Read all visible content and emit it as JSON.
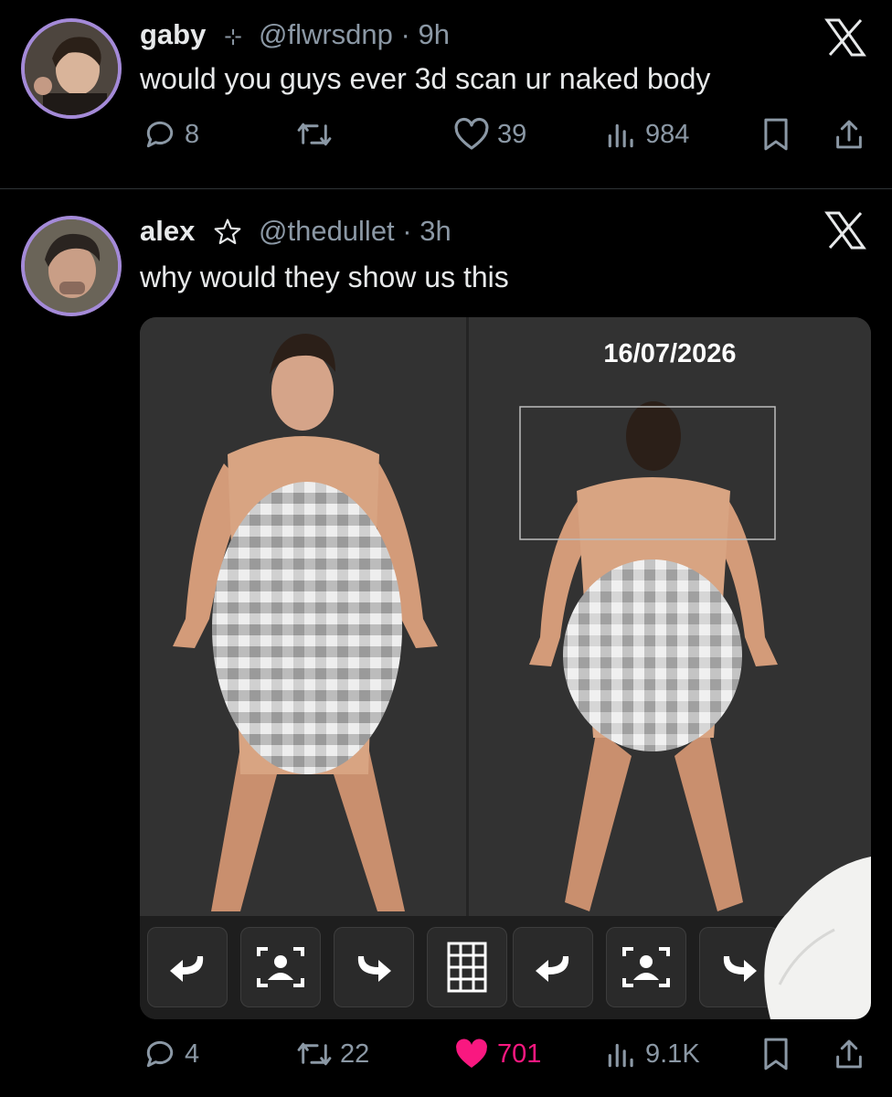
{
  "post1": {
    "display_name": "gaby",
    "handle_time": "@flwrsdnp · 9h",
    "text": "would you guys ever 3d scan ur naked body",
    "replies": "8",
    "reposts": "",
    "likes": "39",
    "views": "984"
  },
  "post2": {
    "display_name": "alex",
    "handle_time": "@thedullet · 3h",
    "text": "why would they show us this",
    "media_date": "16/07/2026",
    "replies": "4",
    "reposts": "22",
    "likes": "701",
    "views": "9.1K"
  },
  "colors": {
    "background": "#000000",
    "text": "#e7e9ea",
    "muted": "#8b98a5",
    "like_active": "#f91880",
    "avatar_ring": "#a48ad8"
  },
  "icons": [
    "reply-icon",
    "repost-icon",
    "like-icon",
    "views-icon",
    "bookmark-icon",
    "share-icon",
    "x-logo-icon",
    "verified-star-icon"
  ]
}
